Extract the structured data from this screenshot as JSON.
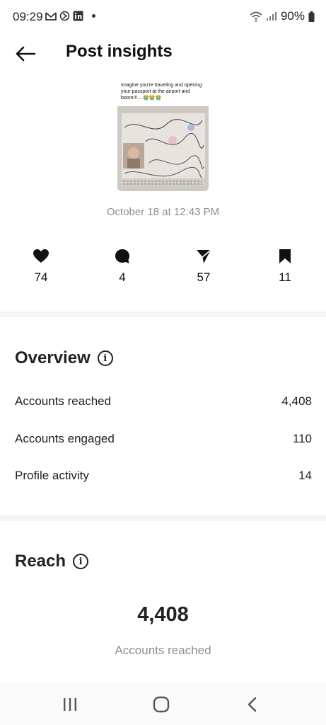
{
  "status_bar": {
    "time": "09:29",
    "battery": "90%",
    "left_icons": [
      "gmail-icon",
      "sync-icon",
      "linkedin-icon",
      "notification-dot-icon"
    ],
    "right_icons": [
      "wifi-icon",
      "signal-icon",
      "battery-icon"
    ]
  },
  "header": {
    "title": "Post insights",
    "back_icon": "arrow-left-icon"
  },
  "post": {
    "caption": "Imagine you're traveling and opening your passport at the airport and boom!!!....😭😭😭",
    "date": "October 18 at 12:43 PM"
  },
  "metrics": [
    {
      "icon": "heart-icon",
      "value": "74"
    },
    {
      "icon": "comment-icon",
      "value": "4"
    },
    {
      "icon": "share-icon",
      "value": "57"
    },
    {
      "icon": "save-icon",
      "value": "11"
    }
  ],
  "overview": {
    "title": "Overview",
    "rows": [
      {
        "label": "Accounts reached",
        "value": "4,408"
      },
      {
        "label": "Accounts engaged",
        "value": "110"
      },
      {
        "label": "Profile activity",
        "value": "14"
      }
    ]
  },
  "reach": {
    "title": "Reach",
    "number": "4,408",
    "label": "Accounts reached"
  },
  "nav": {
    "icons": [
      "recent-apps-icon",
      "home-icon",
      "back-icon"
    ]
  },
  "colors": {
    "text": "#111111",
    "muted": "#8e8e8e",
    "divider": "#f4f4f4"
  }
}
